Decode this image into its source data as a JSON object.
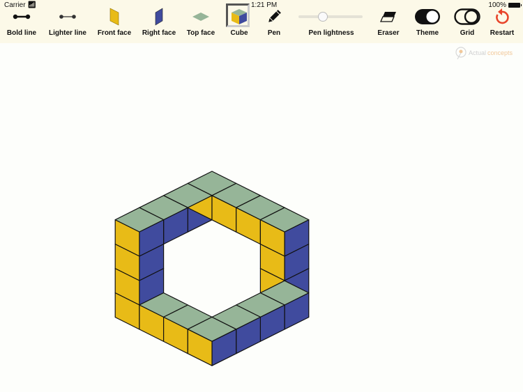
{
  "status_bar": {
    "carrier": "Carrier",
    "time": "1:21 PM",
    "battery": "100%"
  },
  "toolbar": {
    "tools": [
      {
        "id": "bold-line",
        "label": "Bold line"
      },
      {
        "id": "lighter-line",
        "label": "Lighter line"
      },
      {
        "id": "front-face",
        "label": "Front face"
      },
      {
        "id": "right-face",
        "label": "Right face"
      },
      {
        "id": "top-face",
        "label": "Top face"
      },
      {
        "id": "cube",
        "label": "Cube",
        "selected": true
      },
      {
        "id": "pen",
        "label": "Pen"
      },
      {
        "id": "pen-lightness",
        "label": "Pen lightness"
      },
      {
        "id": "eraser",
        "label": "Eraser"
      },
      {
        "id": "theme",
        "label": "Theme"
      },
      {
        "id": "grid",
        "label": "Grid"
      },
      {
        "id": "restart",
        "label": "Restart"
      }
    ],
    "pen_lightness_value": 0.37
  },
  "watermark": {
    "part1": "Actual",
    "part2": "concepts"
  },
  "colors": {
    "front": "#e8bb17",
    "right": "#404b9e",
    "top": "#96b598",
    "restart": "#e8442a"
  },
  "drawing": {
    "description": "Isometric impossible ring of cubes",
    "top_faces": [
      [
        0,
        0,
        0
      ],
      [
        0,
        1,
        0
      ],
      [
        0,
        2,
        0
      ],
      [
        0,
        3,
        0
      ],
      [
        1,
        0,
        0
      ],
      [
        2,
        0,
        0
      ],
      [
        3,
        0,
        0
      ],
      [
        1,
        3,
        3
      ],
      [
        2,
        3,
        3
      ],
      [
        3,
        3,
        3
      ],
      [
        3,
        0,
        3
      ],
      [
        3,
        1,
        3
      ],
      [
        3,
        2,
        3
      ]
    ],
    "front_faces": [
      [
        0,
        4,
        0
      ],
      [
        0,
        4,
        1
      ],
      [
        0,
        4,
        2
      ],
      [
        0,
        4,
        3
      ],
      [
        0,
        1,
        0
      ],
      [
        1,
        1,
        0
      ],
      [
        2,
        1,
        0
      ],
      [
        3,
        1,
        0
      ],
      [
        3,
        1,
        1
      ],
      [
        3,
        1,
        2
      ],
      [
        1,
        4,
        3
      ],
      [
        2,
        4,
        3
      ],
      [
        3,
        4,
        3
      ]
    ],
    "right_faces": [
      [
        1,
        0,
        0
      ],
      [
        1,
        1,
        0
      ],
      [
        1,
        2,
        0
      ],
      [
        1,
        3,
        0
      ],
      [
        1,
        3,
        1
      ],
      [
        1,
        3,
        2
      ],
      [
        4,
        0,
        0
      ],
      [
        4,
        0,
        1
      ],
      [
        4,
        0,
        2
      ],
      [
        4,
        0,
        3
      ],
      [
        4,
        1,
        3
      ],
      [
        4,
        2,
        3
      ],
      [
        4,
        3,
        3
      ]
    ]
  }
}
